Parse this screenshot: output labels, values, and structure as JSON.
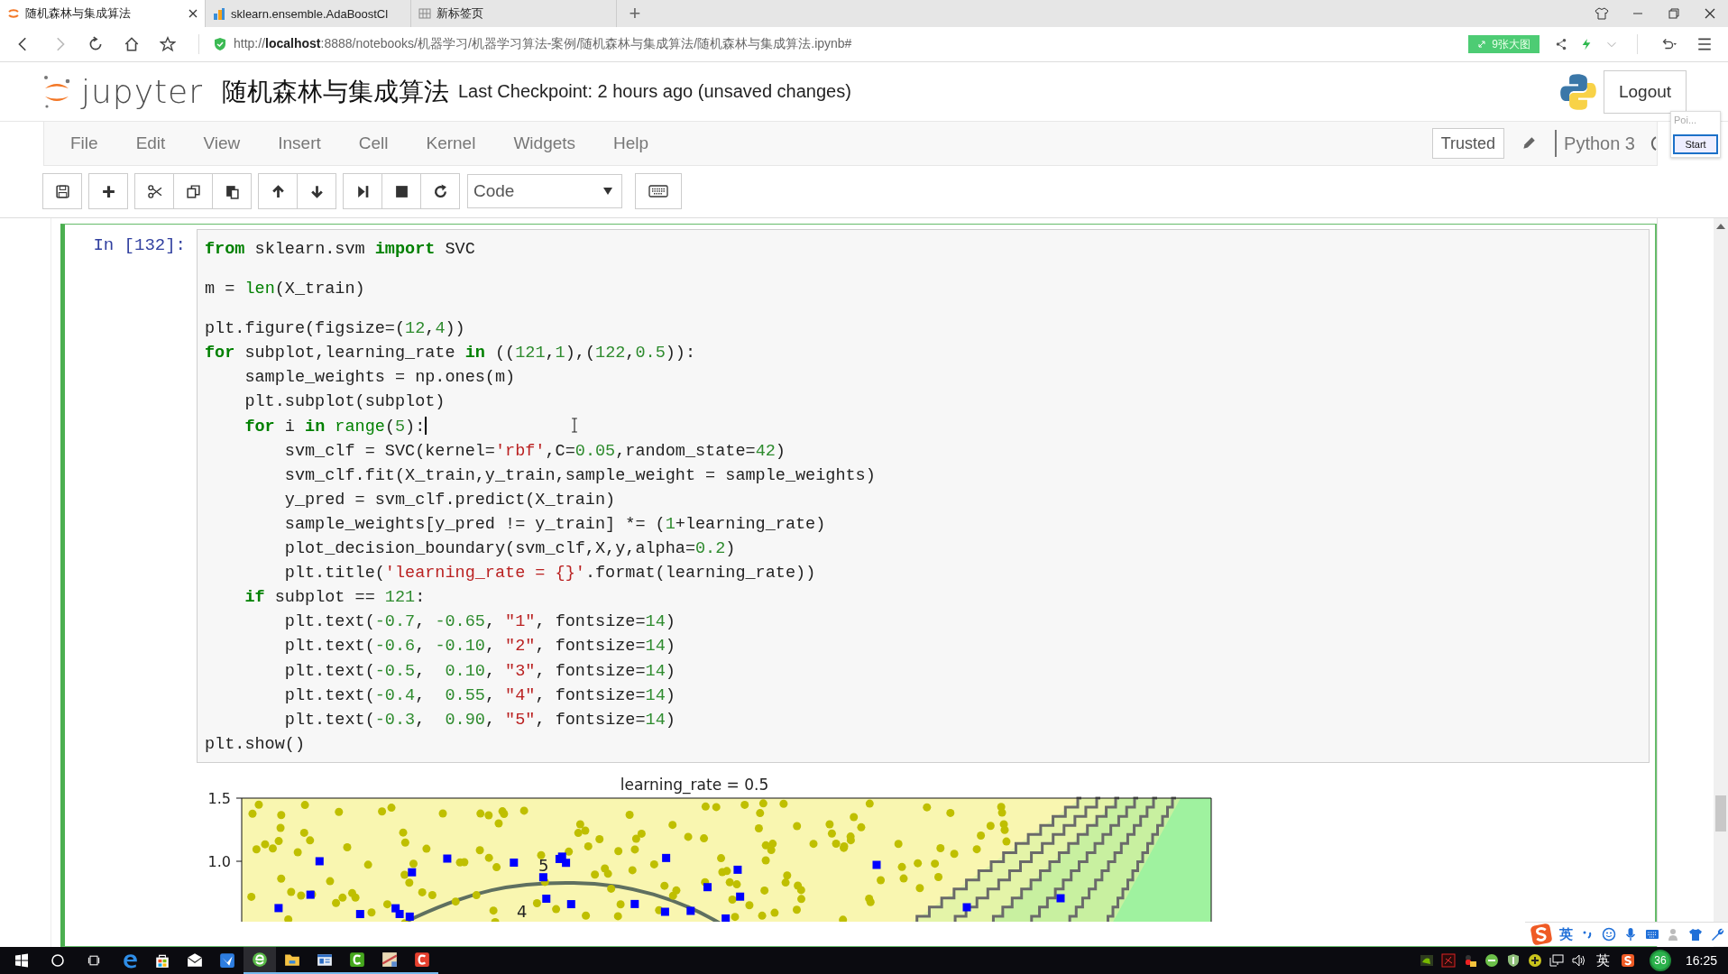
{
  "browser": {
    "tabs": [
      {
        "title": "随机森林与集成算法",
        "selected": true,
        "kind": "jupyter"
      },
      {
        "title": "sklearn.ensemble.AdaBoostCl",
        "selected": false,
        "kind": "docs"
      },
      {
        "title": "新标签页",
        "selected": false,
        "kind": "grid"
      }
    ],
    "new_tab": "+",
    "url": "http://**localhost**:8888/notebooks/机器学习/机器学习算法-案例/随机森林与集成算法/随机森林与集成算法.ipynb#",
    "extension_button": "9张大图"
  },
  "header": {
    "logo_text": "jupyter",
    "notebook_title": "随机森林与集成算法",
    "checkpoint": "Last Checkpoint: 2 hours ago (unsaved changes)",
    "logout": "Logout"
  },
  "popup": {
    "label": "Poi...",
    "button": "Start"
  },
  "menu": {
    "items": [
      "File",
      "Edit",
      "View",
      "Insert",
      "Cell",
      "Kernel",
      "Widgets",
      "Help"
    ],
    "trusted": "Trusted",
    "kernel": "Python 3"
  },
  "toolbar": {
    "buttons": [
      {
        "kind": "save"
      },
      {
        "kind": "add"
      },
      {
        "kind": "cut"
      },
      {
        "kind": "copy"
      },
      {
        "kind": "paste"
      },
      {
        "kind": "up"
      },
      {
        "kind": "down"
      },
      {
        "kind": "run"
      },
      {
        "kind": "stop"
      },
      {
        "kind": "restart"
      }
    ],
    "cell_type": "Code"
  },
  "cell": {
    "prompt": "In [132]:",
    "lines": [
      {
        "tokens": [
          {
            "kind": "keyword",
            "text": "from"
          },
          {
            "kind": "plain",
            "text": " sklearn.svm "
          },
          {
            "kind": "keyword",
            "text": "import"
          },
          {
            "kind": "plain",
            "text": " SVC"
          }
        ]
      },
      {
        "space_before": true,
        "tokens": [
          {
            "kind": "plain",
            "text": "m = "
          },
          {
            "kind": "builtin",
            "text": "len"
          },
          {
            "kind": "plain",
            "text": "(X_train)"
          }
        ]
      },
      {
        "space_before": true,
        "tokens": [
          {
            "kind": "plain",
            "text": "plt.figure(figsize=("
          },
          {
            "kind": "number",
            "text": "12"
          },
          {
            "kind": "plain",
            "text": ","
          },
          {
            "kind": "number",
            "text": "4"
          },
          {
            "kind": "plain",
            "text": "))"
          }
        ]
      },
      {
        "tokens": [
          {
            "kind": "keyword",
            "text": "for"
          },
          {
            "kind": "plain",
            "text": " subplot,learning_rate "
          },
          {
            "kind": "keyword",
            "text": "in"
          },
          {
            "kind": "plain",
            "text": " (("
          },
          {
            "kind": "number",
            "text": "121"
          },
          {
            "kind": "plain",
            "text": ","
          },
          {
            "kind": "number",
            "text": "1"
          },
          {
            "kind": "plain",
            "text": "),("
          },
          {
            "kind": "number",
            "text": "122"
          },
          {
            "kind": "plain",
            "text": ","
          },
          {
            "kind": "number",
            "text": "0.5"
          },
          {
            "kind": "plain",
            "text": ")):"
          }
        ]
      },
      {
        "tokens": [
          {
            "kind": "plain",
            "text": "    sample_weights = np.ones(m)"
          }
        ]
      },
      {
        "tokens": [
          {
            "kind": "plain",
            "text": "    plt.subplot(subplot)"
          }
        ]
      },
      {
        "caret": true,
        "tokens": [
          {
            "kind": "keyword",
            "text": "    for"
          },
          {
            "kind": "plain",
            "text": " i "
          },
          {
            "kind": "keyword",
            "text": "in"
          },
          {
            "kind": "builtin",
            "text": " range"
          },
          {
            "kind": "plain",
            "text": "("
          },
          {
            "kind": "number",
            "text": "5"
          },
          {
            "kind": "plain",
            "text": "):"
          }
        ]
      },
      {
        "tokens": [
          {
            "kind": "plain",
            "text": "        svm_clf = SVC(kernel="
          },
          {
            "kind": "string",
            "text": "'rbf'"
          },
          {
            "kind": "plain",
            "text": ",C="
          },
          {
            "kind": "number",
            "text": "0.05"
          },
          {
            "kind": "plain",
            "text": ",random_state="
          },
          {
            "kind": "number",
            "text": "42"
          },
          {
            "kind": "plain",
            "text": ")"
          }
        ]
      },
      {
        "tokens": [
          {
            "kind": "plain",
            "text": "        svm_clf.fit(X_train,y_train,sample_weight = sample_weights)"
          }
        ]
      },
      {
        "tokens": [
          {
            "kind": "plain",
            "text": "        y_pred = svm_clf.predict(X_train)"
          }
        ]
      },
      {
        "tokens": [
          {
            "kind": "plain",
            "text": "        sample_weights[y_pred != y_train] *= ("
          },
          {
            "kind": "number",
            "text": "1"
          },
          {
            "kind": "plain",
            "text": "+learning_rate)"
          }
        ]
      },
      {
        "tokens": [
          {
            "kind": "plain",
            "text": "        plot_decision_boundary(svm_clf,X,y,alpha="
          },
          {
            "kind": "number",
            "text": "0.2"
          },
          {
            "kind": "plain",
            "text": ")"
          }
        ]
      },
      {
        "tokens": [
          {
            "kind": "plain",
            "text": "        plt.title("
          },
          {
            "kind": "string",
            "text": "'learning_rate = {}'"
          },
          {
            "kind": "plain",
            "text": ".format(learning_rate))"
          }
        ]
      },
      {
        "tokens": [
          {
            "kind": "keyword",
            "text": "    if"
          },
          {
            "kind": "plain",
            "text": " subplot == "
          },
          {
            "kind": "number",
            "text": "121"
          },
          {
            "kind": "plain",
            "text": ":"
          }
        ]
      },
      {
        "tokens": [
          {
            "kind": "plain",
            "text": "        plt.text("
          },
          {
            "kind": "number",
            "text": "-0.7"
          },
          {
            "kind": "plain",
            "text": ", "
          },
          {
            "kind": "number",
            "text": "-0.65"
          },
          {
            "kind": "plain",
            "text": ", "
          },
          {
            "kind": "string",
            "text": "\"1\""
          },
          {
            "kind": "plain",
            "text": ", fontsize="
          },
          {
            "kind": "number",
            "text": "14"
          },
          {
            "kind": "plain",
            "text": ")"
          }
        ]
      },
      {
        "tokens": [
          {
            "kind": "plain",
            "text": "        plt.text("
          },
          {
            "kind": "number",
            "text": "-0.6"
          },
          {
            "kind": "plain",
            "text": ", "
          },
          {
            "kind": "number",
            "text": "-0.10"
          },
          {
            "kind": "plain",
            "text": ", "
          },
          {
            "kind": "string",
            "text": "\"2\""
          },
          {
            "kind": "plain",
            "text": ", fontsize="
          },
          {
            "kind": "number",
            "text": "14"
          },
          {
            "kind": "plain",
            "text": ")"
          }
        ]
      },
      {
        "tokens": [
          {
            "kind": "plain",
            "text": "        plt.text("
          },
          {
            "kind": "number",
            "text": "-0.5"
          },
          {
            "kind": "plain",
            "text": ",  "
          },
          {
            "kind": "number",
            "text": "0.10"
          },
          {
            "kind": "plain",
            "text": ", "
          },
          {
            "kind": "string",
            "text": "\"3\""
          },
          {
            "kind": "plain",
            "text": ", fontsize="
          },
          {
            "kind": "number",
            "text": "14"
          },
          {
            "kind": "plain",
            "text": ")"
          }
        ]
      },
      {
        "tokens": [
          {
            "kind": "plain",
            "text": "        plt.text("
          },
          {
            "kind": "number",
            "text": "-0.4"
          },
          {
            "kind": "plain",
            "text": ",  "
          },
          {
            "kind": "number",
            "text": "0.55"
          },
          {
            "kind": "plain",
            "text": ", "
          },
          {
            "kind": "string",
            "text": "\"4\""
          },
          {
            "kind": "plain",
            "text": ", fontsize="
          },
          {
            "kind": "number",
            "text": "14"
          },
          {
            "kind": "plain",
            "text": ")"
          }
        ]
      },
      {
        "tokens": [
          {
            "kind": "plain",
            "text": "        plt.text("
          },
          {
            "kind": "number",
            "text": "-0.3"
          },
          {
            "kind": "plain",
            "text": ",  "
          },
          {
            "kind": "number",
            "text": "0.90"
          },
          {
            "kind": "plain",
            "text": ", "
          },
          {
            "kind": "string",
            "text": "\"5\""
          },
          {
            "kind": "plain",
            "text": ", fontsize="
          },
          {
            "kind": "number",
            "text": "14"
          },
          {
            "kind": "plain",
            "text": ")"
          }
        ]
      },
      {
        "tokens": [
          {
            "kind": "plain",
            "text": "plt.show()"
          }
        ]
      }
    ]
  },
  "plot": {
    "title": "learning_rate = 0.5",
    "ytick_labels": [
      "1.5",
      "1.0"
    ],
    "annotations": [
      "5",
      "4"
    ]
  },
  "ime_bar": {
    "mode": "英"
  },
  "taskbar": {
    "apps": [
      {
        "kind": "edge",
        "running": false,
        "selected": false
      },
      {
        "kind": "store",
        "running": false,
        "selected": false
      },
      {
        "kind": "mail",
        "running": false,
        "selected": false
      },
      {
        "kind": "bird",
        "running": false,
        "selected": false
      },
      {
        "kind": "browser",
        "running": true,
        "selected": true
      },
      {
        "kind": "folder",
        "running": true,
        "selected": false
      },
      {
        "kind": "window",
        "running": true,
        "selected": false
      },
      {
        "kind": "green-c",
        "running": true,
        "selected": false
      },
      {
        "kind": "map",
        "running": true,
        "selected": false
      },
      {
        "kind": "red-c",
        "running": true,
        "selected": false
      }
    ],
    "input_mode": "英",
    "badge": "36",
    "time": "16:25"
  }
}
